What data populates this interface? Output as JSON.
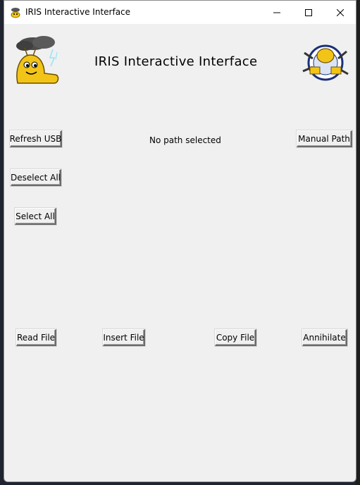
{
  "window": {
    "title": "IRIS Interactive Interface"
  },
  "header": {
    "title": "IRIS Interactive Interface"
  },
  "controls": {
    "refresh_usb": "Refresh USB",
    "path_status": "No path selected",
    "manual_path": "Manual Path",
    "deselect_all": "Deselect All",
    "select_all": "Select All"
  },
  "actions": {
    "read_file": "Read File",
    "insert_file": "Insert File",
    "copy_file": "Copy File",
    "annihilate": "Annihilate"
  },
  "icons": {
    "app": "slug-mascot-icon",
    "left_logo": "storm-slug-icon",
    "right_logo": "slug-badge-icon",
    "minimize": "minimize-icon",
    "maximize": "maximize-icon",
    "close": "close-icon"
  }
}
